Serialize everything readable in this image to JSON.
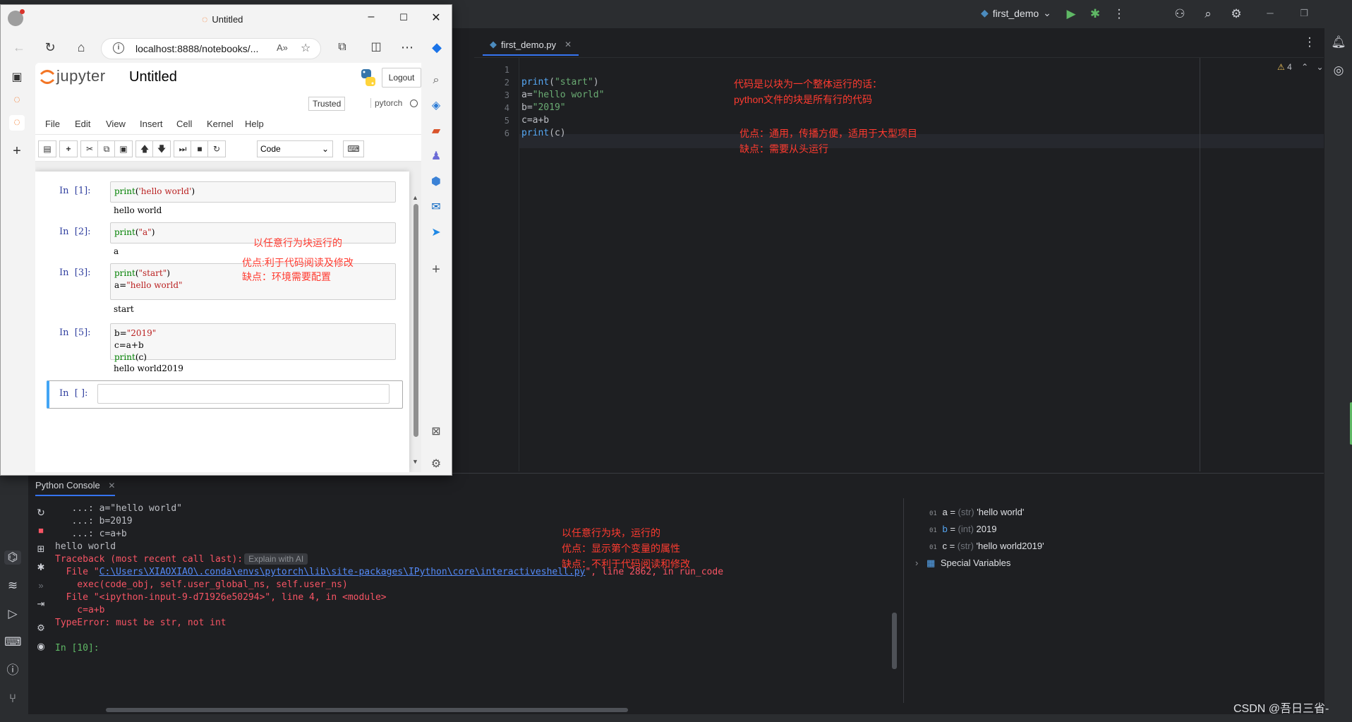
{
  "ide": {
    "project_name": "first_demo",
    "file_tab": "first_demo.py",
    "warning_count": "4",
    "code_lines": [
      {
        "num": "1",
        "parts": []
      },
      {
        "num": "2",
        "parts": [
          {
            "t": "print",
            "c": "k-fn"
          },
          {
            "t": "(",
            "c": "k-plain"
          },
          {
            "t": "\"start\"",
            "c": "k-str"
          },
          {
            "t": ")",
            "c": "k-plain"
          }
        ]
      },
      {
        "num": "3",
        "parts": [
          {
            "t": "a=",
            "c": "k-plain"
          },
          {
            "t": "\"hello world\"",
            "c": "k-str"
          }
        ]
      },
      {
        "num": "4",
        "parts": [
          {
            "t": "b=",
            "c": "k-plain"
          },
          {
            "t": "\"2019\"",
            "c": "k-str"
          }
        ]
      },
      {
        "num": "5",
        "parts": [
          {
            "t": "c=a+b",
            "c": "k-plain"
          }
        ]
      },
      {
        "num": "6",
        "parts": [
          {
            "t": "print",
            "c": "k-fn"
          },
          {
            "t": "(c)",
            "c": "k-plain"
          }
        ]
      }
    ],
    "editor_notes": {
      "line1": "代码是以块为一个整体运行的话：",
      "line2": "python文件的块是所有行的代码",
      "line3": "优点：通用，传播方便，适用于大型项目",
      "line4": "缺点：需要从头运行"
    },
    "console_tab": "Python Console",
    "console_lines": [
      {
        "text": "   ...: a=\"hello world\"",
        "kind": "normal"
      },
      {
        "text": "   ...: b=2019",
        "kind": "normal"
      },
      {
        "text": "   ...: c=a+b",
        "kind": "normal"
      },
      {
        "text": "hello world",
        "kind": "normal"
      },
      {
        "text": "Traceback (most recent call last):",
        "kind": "err"
      },
      {
        "text": "  File \"",
        "kind": "err"
      },
      {
        "text": "    exec(code_obj, self.user_global_ns, self.user_ns)",
        "kind": "err"
      },
      {
        "text": "  File \"<ipython-input-9-d71926e50294>\", line 4, in <module>",
        "kind": "err"
      },
      {
        "text": "    c=a+b",
        "kind": "err"
      },
      {
        "text": "TypeError: must be str, not int",
        "kind": "err"
      },
      {
        "text": "",
        "kind": "normal"
      },
      {
        "text": "In [10]:",
        "kind": "prompt"
      }
    ],
    "explain_ai": "Explain with AI",
    "traceback_link": "C:\\Users\\XIAOXIAO\\.conda\\envs\\pytorch\\lib\\site-packages\\IPython\\core\\interactiveshell.py",
    "traceback_tail": "\", line 2862, in run_code",
    "console_notes": {
      "line1": "以任意行为块，运行的",
      "line2": "优点：显示第个变量的属性",
      "line3": "缺点：不利于代码阅读和修改"
    },
    "variables": [
      {
        "name": "a",
        "type": "(str)",
        "value": "'hello world'"
      },
      {
        "name": "b",
        "type": "(int)",
        "value": "2019"
      },
      {
        "name": "c",
        "type": "(str)",
        "value": "'hello world2019'"
      }
    ],
    "special_variables": "Special Variables",
    "watermark": "CSDN @吾日三省-"
  },
  "browser": {
    "window_title": "Untitled",
    "url": "localhost:8888/notebooks/...",
    "jupyter": {
      "logo_text": "jupyter",
      "notebook_name": "Untitled",
      "logout": "Logout",
      "trusted": "Trusted",
      "kernel": "pytorch",
      "menu": [
        "File",
        "Edit",
        "View",
        "Insert",
        "Cell",
        "Kernel",
        "Help"
      ],
      "cell_type": "Code",
      "cells": [
        {
          "prompt": "In  [1]:",
          "lines": [
            [
              {
                "t": "print",
                "c": "j-green"
              },
              {
                "t": "(",
                "c": ""
              },
              {
                "t": "'hello world'",
                "c": "j-red"
              },
              {
                "t": ")",
                "c": ""
              }
            ]
          ],
          "output": "hello world"
        },
        {
          "prompt": "In  [2]:",
          "lines": [
            [
              {
                "t": "print",
                "c": "j-green"
              },
              {
                "t": "(",
                "c": ""
              },
              {
                "t": "\"a\"",
                "c": "j-red"
              },
              {
                "t": ")",
                "c": ""
              }
            ]
          ],
          "output": "a"
        },
        {
          "prompt": "In  [3]:",
          "lines": [
            [
              {
                "t": "print",
                "c": "j-green"
              },
              {
                "t": "(",
                "c": ""
              },
              {
                "t": "\"start\"",
                "c": "j-red"
              },
              {
                "t": ")",
                "c": ""
              }
            ],
            [
              {
                "t": "a=",
                "c": ""
              },
              {
                "t": "\"hello world\"",
                "c": "j-red"
              }
            ]
          ],
          "output": "start"
        },
        {
          "prompt": "In  [5]:",
          "lines": [
            [
              {
                "t": "b=",
                "c": ""
              },
              {
                "t": "\"2019\"",
                "c": "j-red"
              }
            ],
            [
              {
                "t": "c=a+b",
                "c": ""
              }
            ],
            [
              {
                "t": "print",
                "c": "j-green"
              },
              {
                "t": "(c)",
                "c": ""
              }
            ]
          ],
          "output": "hello world2019"
        }
      ],
      "empty_prompt": "In  [ ]:",
      "notes": {
        "line1": "以任意行为块运行的",
        "line2": "优点:利于代码阅读及修改",
        "line3": "缺点：环境需要配置"
      }
    }
  }
}
